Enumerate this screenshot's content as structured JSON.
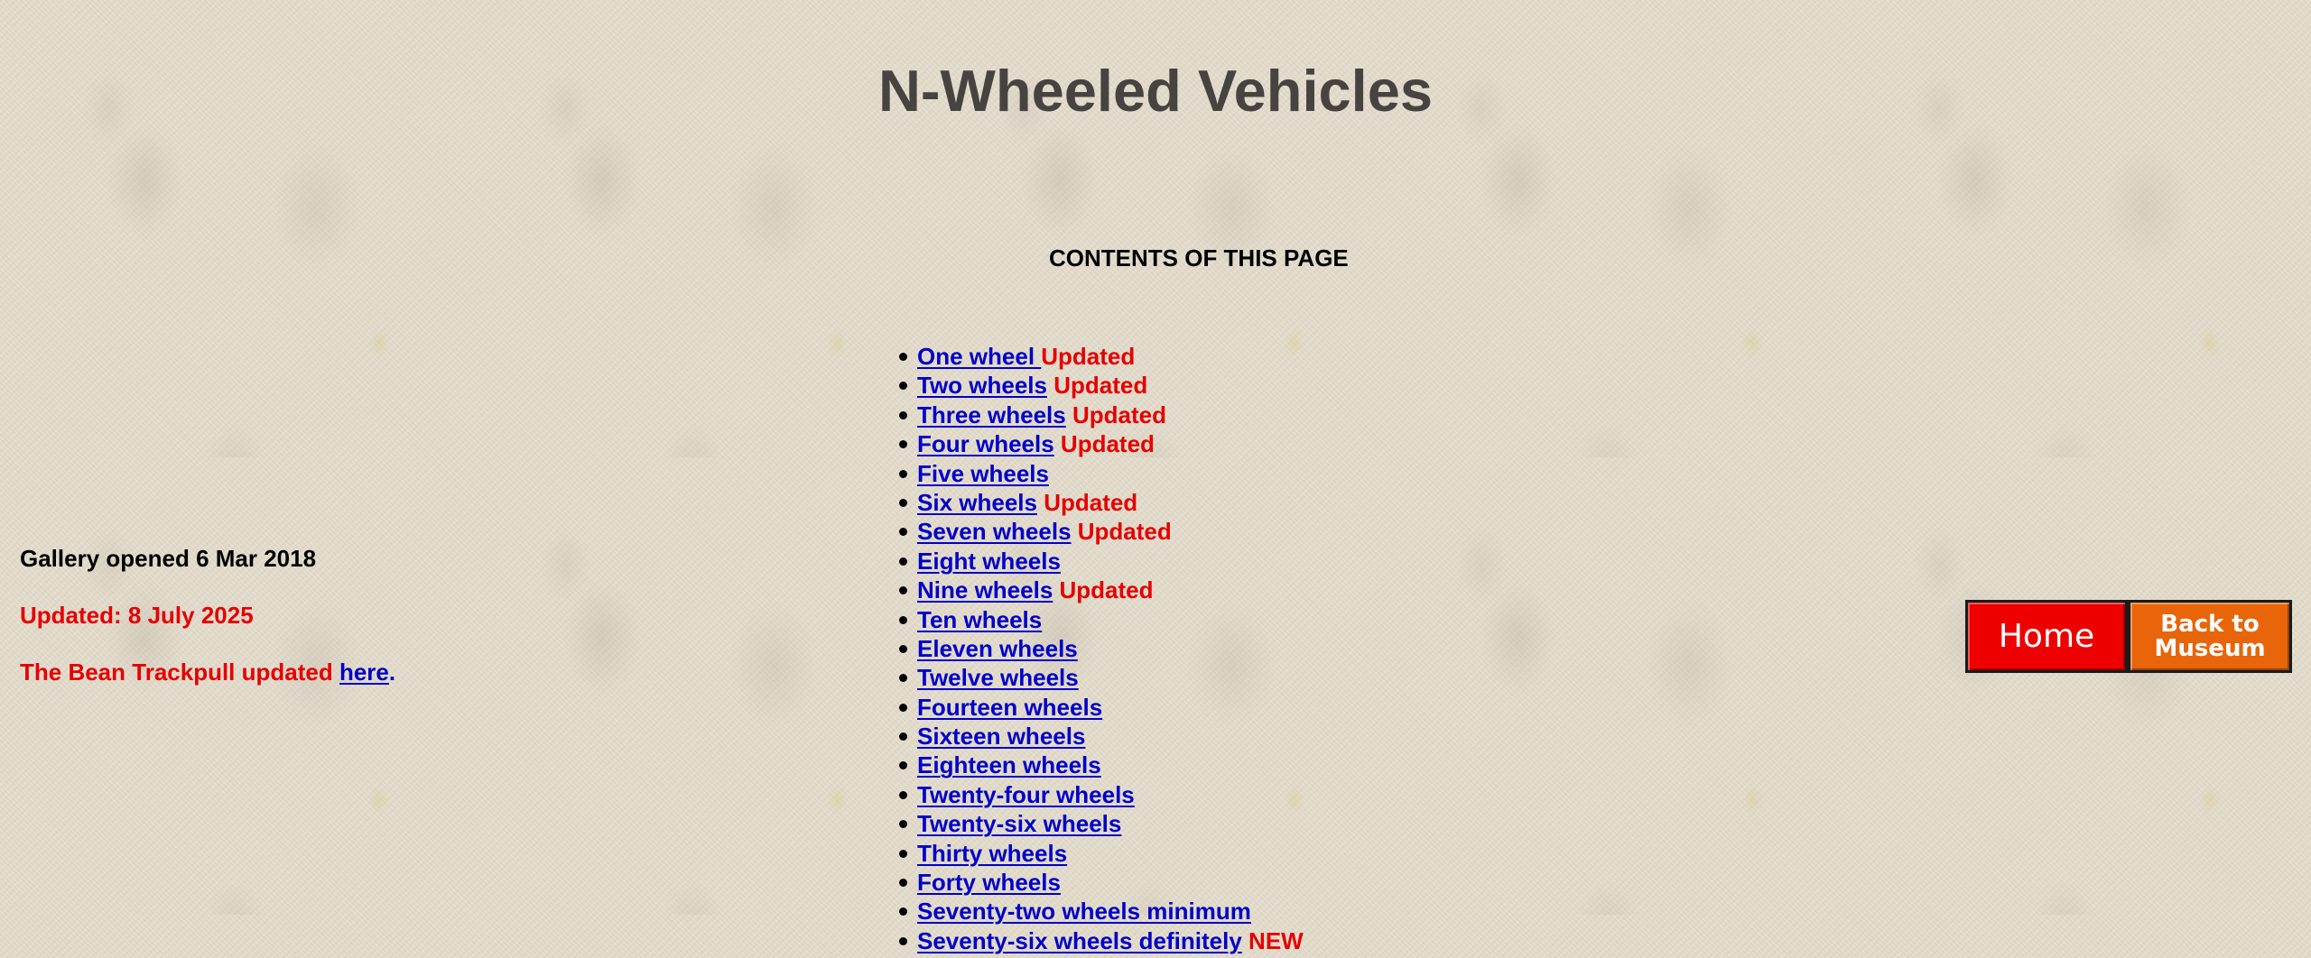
{
  "header": {
    "title": "N-Wheeled Vehicles"
  },
  "contents": {
    "heading": "CONTENTS OF THIS PAGE",
    "items": [
      {
        "label": "One wheel ",
        "tag": "Updated"
      },
      {
        "label": "Two wheels",
        "tag": " Updated"
      },
      {
        "label": "Three wheels",
        "tag": " Updated"
      },
      {
        "label": "Four wheels",
        "tag": " Updated"
      },
      {
        "label": "Five wheels",
        "tag": ""
      },
      {
        "label": "Six wheels",
        "tag": " Updated"
      },
      {
        "label": "Seven wheels",
        "tag": " Updated"
      },
      {
        "label": "Eight wheels",
        "tag": ""
      },
      {
        "label": "Nine wheels",
        "tag": " Updated"
      },
      {
        "label": "Ten wheels",
        "tag": ""
      },
      {
        "label": "Eleven wheels",
        "tag": ""
      },
      {
        "label": "Twelve wheels",
        "tag": ""
      },
      {
        "label": "Fourteen wheels",
        "tag": ""
      },
      {
        "label": "Sixteen wheels",
        "tag": ""
      },
      {
        "label": "Eighteen wheels",
        "tag": ""
      },
      {
        "label": "Twenty-four wheels",
        "tag": ""
      },
      {
        "label": "Twenty-six wheels",
        "tag": ""
      },
      {
        "label": "Thirty wheels",
        "tag": ""
      },
      {
        "label": "Forty wheels",
        "tag": ""
      },
      {
        "label": "Seventy-two wheels minimum",
        "tag": ""
      },
      {
        "label": "Seventy-six wheels definitely",
        "tag": " NEW"
      }
    ]
  },
  "side_info": {
    "opened": "Gallery opened 6 Mar 2018",
    "updated": "Updated: 8 July 2025",
    "bean_text": "The Bean Trackpull updated ",
    "bean_link": "here",
    "bean_end": "."
  },
  "nav": {
    "home_label": "Home",
    "museum_line1": "Back to",
    "museum_line2": "Museum"
  },
  "colors": {
    "link": "#0000c8",
    "tag": "#e60000",
    "title": "#464340",
    "home_button": "#ee0000",
    "museum_button": "#e8650a"
  }
}
